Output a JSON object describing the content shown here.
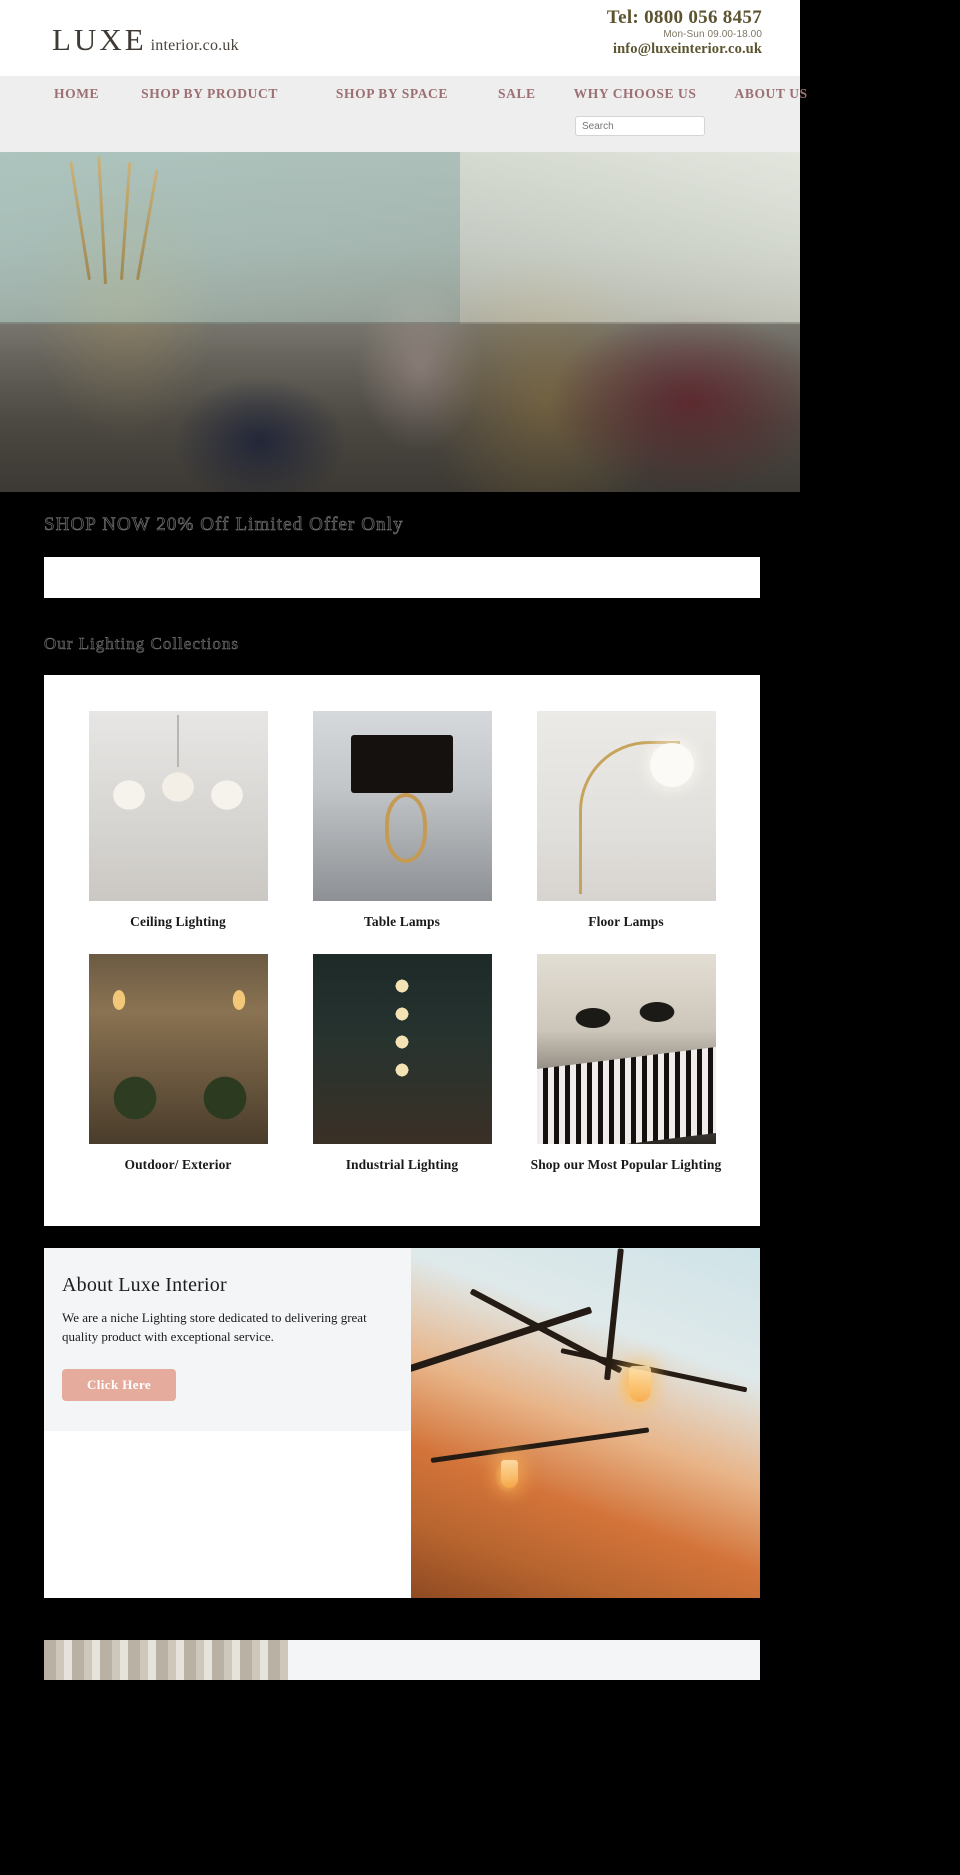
{
  "header": {
    "logo_main": "LUXE",
    "logo_sub": "interior.co.uk",
    "tel": "Tel: 0800 056 8457",
    "hours": "Mon-Sun 09.00-18.00",
    "email": "info@luxeinterior.co.uk"
  },
  "nav": {
    "items": [
      {
        "label": "HOME"
      },
      {
        "label": "SHOP BY PRODUCT"
      },
      {
        "label": "SHOP BY SPACE"
      },
      {
        "label": "SALE"
      },
      {
        "label": "WHY CHOOSE US"
      },
      {
        "label": "ABOUT US"
      }
    ]
  },
  "search": {
    "placeholder": "Search",
    "value": ""
  },
  "promo": {
    "title": "SHOP NOW 20% Off Limited Offer Only"
  },
  "collections": {
    "title": "Our Lighting Collections",
    "items": [
      {
        "label": "Ceiling Lighting",
        "art": "t-ceiling"
      },
      {
        "label": "Table Lamps",
        "art": "t-table"
      },
      {
        "label": "Floor Lamps",
        "art": "t-floor"
      },
      {
        "label": "Outdoor/ Exterior",
        "art": "t-outdoor"
      },
      {
        "label": "Industrial Lighting",
        "art": "t-industrial"
      },
      {
        "label": "Shop our Most Popular Lighting",
        "art": "t-popular"
      }
    ]
  },
  "about": {
    "heading": "About Luxe Interior",
    "body": "We are a niche Lighting store dedicated to delivering great quality product with exceptional service.",
    "button_label": "Click Here"
  },
  "colors": {
    "nav_link": "#9c6f72",
    "contact_text": "#5c5430",
    "button_bg": "#e5ab9d",
    "nav_bg": "#eeeeee",
    "page_bg": "#000000",
    "panel_bg": "#f4f5f7"
  }
}
